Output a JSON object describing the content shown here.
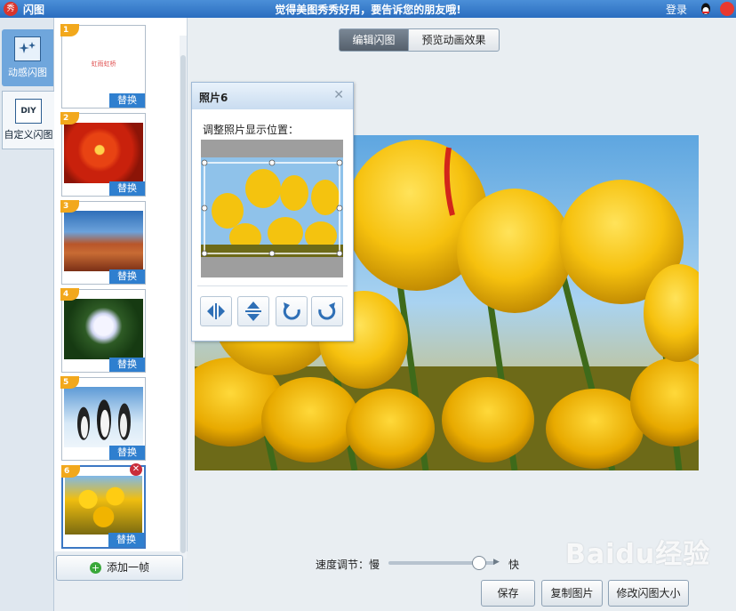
{
  "window": {
    "app_title": "闪图",
    "slogan": "觉得美图秀秀好用，要告诉您的朋友哦!",
    "login": "登录"
  },
  "modes": [
    {
      "label": "动感闪图",
      "icon": "sparkle-frame-icon",
      "active": true
    },
    {
      "label": "自定义闪图",
      "icon": "diy-icon",
      "icon_text": "DIY",
      "active": false
    }
  ],
  "thumbnails": [
    {
      "num": "1",
      "replace": "替换",
      "caption": "虹雨虹桥",
      "icon": "text-frame-image"
    },
    {
      "num": "2",
      "replace": "替换",
      "icon": "red-flower-image"
    },
    {
      "num": "3",
      "replace": "替换",
      "icon": "desert-image"
    },
    {
      "num": "4",
      "replace": "替换",
      "icon": "white-flower-image"
    },
    {
      "num": "5",
      "replace": "替换",
      "icon": "penguins-image"
    },
    {
      "num": "6",
      "replace": "替换",
      "icon": "tulips-image",
      "selected": true
    }
  ],
  "add_frame": "添加一帧",
  "tabs": [
    {
      "label": "编辑闪图",
      "active": true
    },
    {
      "label": "预览动画效果",
      "active": false
    }
  ],
  "popup": {
    "title": "照片6",
    "instruction": "调整照片显示位置：",
    "buttons": [
      "flip-horizontal-icon",
      "flip-vertical-icon",
      "rotate-left-icon",
      "rotate-right-icon"
    ]
  },
  "speed": {
    "label": "速度调节：慢",
    "fast": "快",
    "value": 0.85
  },
  "actions": {
    "save": "保存",
    "copy": "复制图片",
    "resize": "修改闪图大小"
  },
  "watermark": "Baidu经验",
  "colors": {
    "accent": "#2f7fcf",
    "badge": "#f2a81c",
    "delete": "#c92d3b"
  }
}
